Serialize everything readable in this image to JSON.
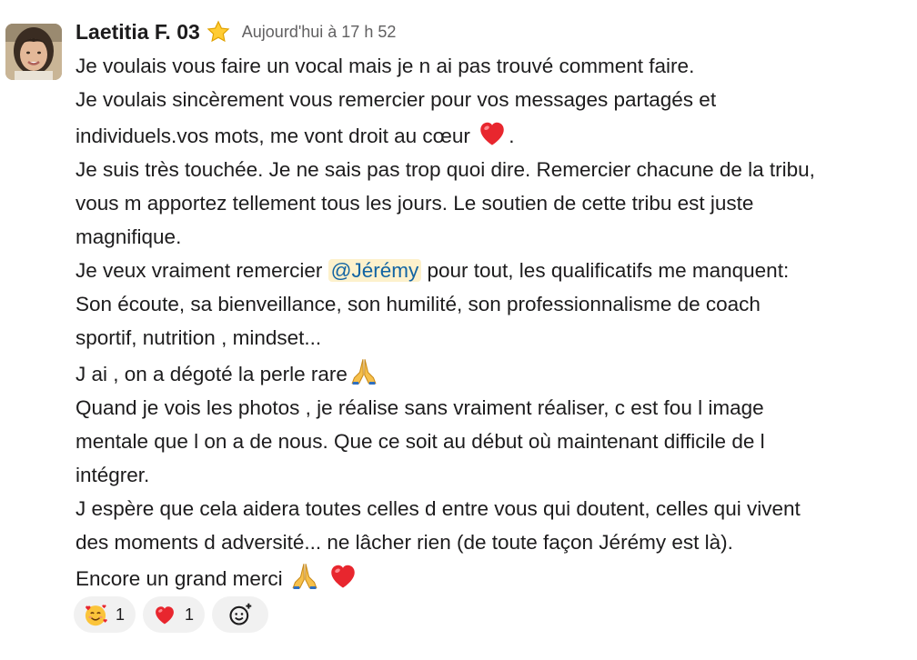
{
  "message": {
    "author": "Laetitia F. 03",
    "status_icon": "star-icon",
    "timestamp": "Aujourd'hui à 17 h 52",
    "lines": [
      "Je voulais vous faire un vocal mais je n ai pas trouvé comment faire.",
      "Je voulais sincèrement vous remercier pour vos messages partagés et",
      "individuels.vos mots, me vont droit au cœur",
      ".",
      "Je suis très touchée. Je ne sais pas trop quoi dire. Remercier chacune de la tribu,",
      "vous m apportez tellement tous les jours. Le soutien de cette tribu est juste",
      "magnifique.",
      "Je veux vraiment remercier",
      "@Jérémy",
      "pour tout, les qualificatifs me manquent:",
      "Son écoute,  sa bienveillance,  son humilité,  son professionnalisme de coach",
      "sportif, nutrition , mindset...",
      "J ai , on a dégoté la perle rare",
      "Quand je vois les photos , je réalise sans vraiment réaliser,  c est fou l image",
      "mentale que l on a de nous. Que ce soit au début où maintenant difficile de l",
      "intégrer.",
      "J espère que cela aidera toutes celles d entre vous qui doutent, celles qui vivent",
      "des moments d adversité... ne lâcher rien (de toute façon Jérémy est là).",
      "Encore un grand merci"
    ]
  },
  "reactions": [
    {
      "icon": "smiling-face-with-hearts-icon",
      "count": "1"
    },
    {
      "icon": "red-heart-icon",
      "count": "1"
    },
    {
      "icon": "add-reaction-icon"
    }
  ],
  "colors": {
    "mention_bg": "#fdf1cc",
    "mention_text": "#1264a3",
    "timestamp": "#616061",
    "reaction_bg": "#f1f1f1"
  }
}
